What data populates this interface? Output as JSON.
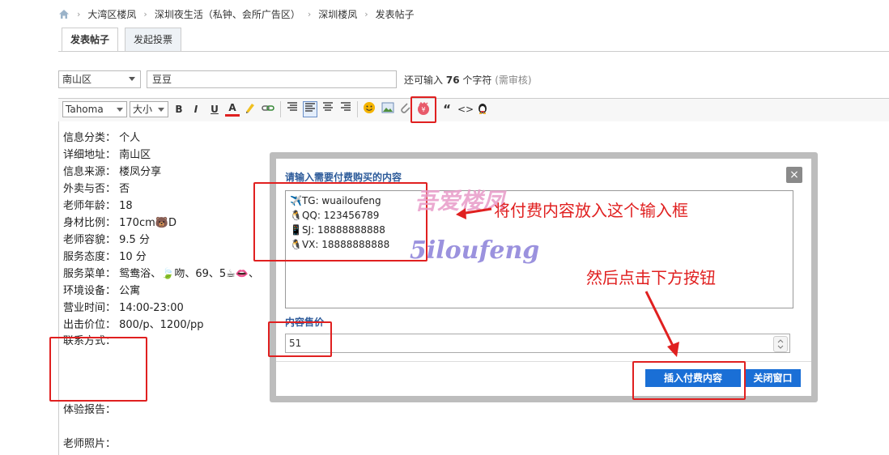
{
  "breadcrumb": [
    "大湾区楼凤",
    "深圳夜生活（私钟、会所广告区）",
    "深圳楼凤",
    "发表帖子"
  ],
  "tabs": [
    {
      "label": "发表帖子",
      "active": true
    },
    {
      "label": "发起投票",
      "active": false
    }
  ],
  "form": {
    "district": "南山区",
    "subject": "豆豆",
    "counter_prefix": "还可输入",
    "counter_value": "76",
    "counter_suffix": "个字符",
    "counter_note": "(需审核)"
  },
  "toolbar": {
    "font": "Tahoma",
    "size": "大小",
    "bold": "B",
    "italic": "I",
    "underline": "U",
    "color": "A",
    "quote": "“",
    "code": "<>"
  },
  "editor_lines": [
    "信息分类：  个人",
    "详细地址：  南山区",
    "信息来源：  楼凤分享",
    "外卖与否：  否",
    "老师年龄：  18",
    "身材比例：  170cm🐻D",
    "老师容貌：  9.5 分",
    "服务态度：  10 分",
    "服务菜单：  鸳鸯浴、🍃吻、69、5☕👄、",
    "环境设备：  公寓",
    "营业时间：  14:00-23:00",
    "出击价位：  800/p、1200/pp",
    "联系方式：",
    "体验报告：",
    "老师照片："
  ],
  "dialog": {
    "title": "请输入需要付费购买的内容",
    "close": "×",
    "content_lines": [
      "✈️TG:  wuailoufeng",
      "🐧QQ: 123456789",
      "📱SJ: 18888888888",
      "🐧VX: 18888888888"
    ],
    "price_label": "内容售价",
    "price_value": "51",
    "insert_button": "插入付费内容",
    "close_button": "关闭窗口"
  },
  "annotations": {
    "put_content": "将付费内容放入这个输入框",
    "click_button": "然后点击下方按钮",
    "watermark_cn": "吾爱楼凤",
    "watermark_en": "5iloufeng"
  },
  "colors": {
    "accent": "#1a6fd6",
    "annotation": "#e02020",
    "dialog_title": "#2d5b9a"
  }
}
